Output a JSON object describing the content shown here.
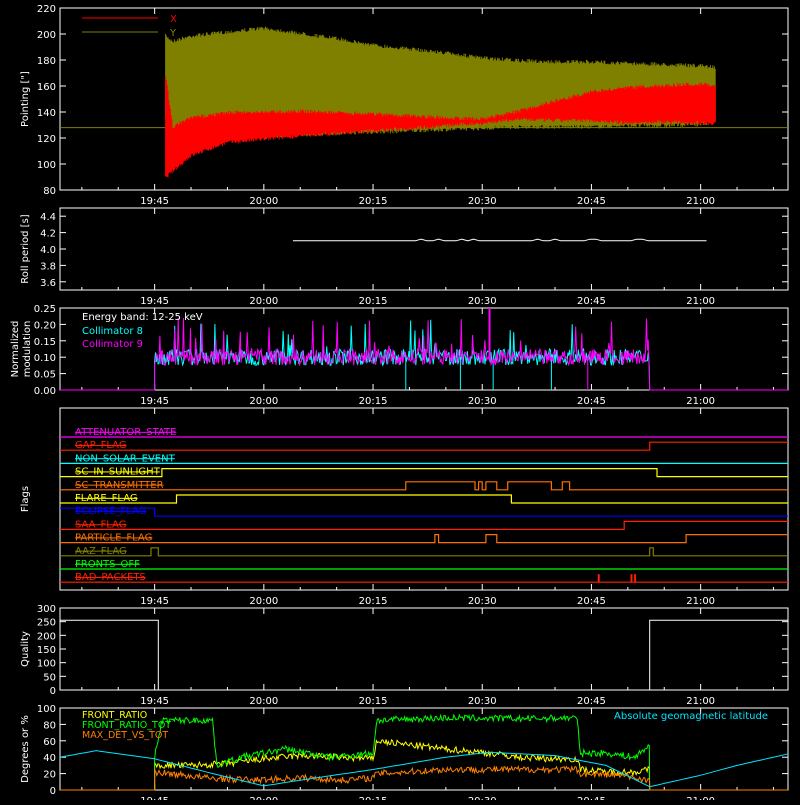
{
  "time_axis": {
    "tick_labels": [
      "19:45",
      "20:00",
      "20:15",
      "20:30",
      "20:45",
      "21:00"
    ],
    "tick_times_min": [
      0,
      15,
      30,
      45,
      60,
      75
    ],
    "range_min": [
      -13,
      87
    ]
  },
  "chart_data": [
    {
      "type": "line",
      "title": "",
      "ylabel": "Pointing [\"]",
      "ylim": [
        80,
        220
      ],
      "yticks": [
        80,
        100,
        120,
        140,
        160,
        180,
        200,
        220
      ],
      "legend": [
        "X",
        "Y"
      ],
      "series": [
        {
          "name": "X",
          "color": "#ff0000",
          "envelope": {
            "t": [
              1.5,
              2.5,
              5,
              10,
              20,
              30,
              40,
              45,
              50,
              55,
              60,
              65,
              70,
              75,
              77
            ],
            "hi": [
              170,
              130,
              137,
              141,
              142,
              140,
              137,
              136,
              142,
              150,
              157,
              160,
              162,
              163,
              162
            ],
            "lo": [
              88,
              93,
              105,
              115,
              120,
              124,
              128,
              130,
              133,
              132,
              132,
              130,
              131,
              130,
              130
            ]
          }
        },
        {
          "name": "Y",
          "color": "#808000",
          "envelope": {
            "t": [
              1.5,
              2.5,
              5,
              10,
              15,
              20,
              25,
              30,
              35,
              40,
              45,
              50,
              55,
              60,
              65,
              70,
              75,
              77
            ],
            "hi": [
              200,
              196,
              200,
              203,
              206,
              202,
              198,
              193,
              190,
              187,
              183,
              181,
              180,
              180,
              179,
              178,
              177,
              176
            ],
            "lo": [
              135,
              126,
              122,
              120,
              119,
              121,
              122,
              123,
              124,
              125,
              126,
              127,
              127,
              127,
              128,
              128,
              129,
              130
            ]
          }
        }
      ],
      "baseline": 128
    },
    {
      "type": "line",
      "title": "",
      "ylabel": "Roll period [s]",
      "ylim": [
        3.5,
        4.5
      ],
      "yticks": [
        3.6,
        3.8,
        4.0,
        4.2,
        4.4
      ],
      "series": [
        {
          "name": "",
          "color": "#ffffff",
          "t_start": 19,
          "t_end": 76,
          "value": 4.1
        }
      ]
    },
    {
      "type": "line",
      "title": "",
      "ylabel": "Normalized modulation",
      "ylim": [
        0,
        0.25
      ],
      "yticks": [
        0.0,
        0.05,
        0.1,
        0.15,
        0.2,
        0.25
      ],
      "annotation": "Energy band: 12-25 keV",
      "series": [
        {
          "name": "Collimator 8",
          "color": "#00ffff",
          "t_start": 0,
          "t_end": 68,
          "mean": 0.1,
          "dropouts": [
            34.5,
            42,
            46.5,
            54.5
          ]
        },
        {
          "name": "Collimator 9",
          "color": "#ff00ff",
          "t_start": 0,
          "t_end": 68,
          "mean": 0.1,
          "spike_t": 46,
          "spike_v": 0.27,
          "dropouts": [
            59.5
          ]
        }
      ]
    },
    {
      "type": "line",
      "title": "",
      "ylabel": "Flags",
      "flags": [
        {
          "name": "ATTENUATOR_STATE",
          "color": "#ff00ff",
          "segments": [
            [
              -13,
              87,
              0
            ]
          ]
        },
        {
          "name": "GAP_FLAG",
          "color": "#ff2000",
          "segments": [
            [
              -13,
              68,
              0
            ],
            [
              68,
              87,
              1
            ]
          ]
        },
        {
          "name": "NON_SOLAR_EVENT",
          "color": "#00ffff",
          "segments": [
            [
              -13,
              87,
              0
            ]
          ]
        },
        {
          "name": "SC_IN_SUNLIGHT",
          "color": "#ffff00",
          "segments": [
            [
              -13,
              1,
              0
            ],
            [
              1,
              69,
              1
            ],
            [
              69,
              87,
              0
            ]
          ]
        },
        {
          "name": "SC_TRANSMITTER",
          "color": "#ff7000",
          "segments": [
            [
              -13,
              34.5,
              0
            ],
            [
              34.5,
              44,
              1
            ],
            [
              44,
              44.5,
              0
            ],
            [
              44.5,
              45,
              1
            ],
            [
              45,
              45.5,
              0
            ],
            [
              45.5,
              47,
              1
            ],
            [
              47,
              48.5,
              0
            ],
            [
              48.5,
              54.5,
              1
            ],
            [
              54.5,
              56,
              0
            ],
            [
              56,
              57,
              1
            ],
            [
              57,
              87,
              0
            ]
          ]
        },
        {
          "name": "FLARE_FLAG",
          "color": "#ffff00",
          "segments": [
            [
              -13,
              3,
              0
            ],
            [
              3,
              49,
              1
            ],
            [
              49,
              87,
              0
            ]
          ]
        },
        {
          "name": "ECLIPSE_FLAG",
          "color": "#0000ff",
          "segments": [
            [
              -13,
              0,
              1
            ],
            [
              0,
              87,
              0
            ]
          ]
        },
        {
          "name": "SAA_FLAG",
          "color": "#ff2000",
          "segments": [
            [
              -13,
              64.5,
              0
            ],
            [
              64.5,
              87,
              1
            ]
          ]
        },
        {
          "name": "PARTICLE_FLAG",
          "color": "#ff7000",
          "segments": [
            [
              -13,
              38.5,
              0
            ],
            [
              38.5,
              39,
              1
            ],
            [
              39,
              45.5,
              0
            ],
            [
              45.5,
              47,
              1
            ],
            [
              47,
              73,
              0
            ],
            [
              73,
              87,
              1
            ]
          ]
        },
        {
          "name": "AAZ_FLAG",
          "color": "#808000",
          "segments": [
            [
              -13,
              -0.5,
              0
            ],
            [
              -0.5,
              0.5,
              1
            ],
            [
              0.5,
              68,
              0
            ],
            [
              68,
              68.5,
              1
            ],
            [
              68.5,
              87,
              0
            ]
          ]
        },
        {
          "name": "FRONTS_OFF",
          "color": "#00ff00",
          "segments": [
            [
              -13,
              87,
              0
            ]
          ]
        },
        {
          "name": "BAD_PACKETS",
          "color": "#ff2000",
          "segments": [
            [
              -13,
              87,
              0
            ]
          ],
          "spikes": [
            61,
            65.5,
            66
          ]
        }
      ]
    },
    {
      "type": "line",
      "title": "",
      "ylabel": "Quality",
      "ylim": [
        0,
        300
      ],
      "yticks": [
        0,
        50,
        100,
        150,
        200,
        250,
        300
      ],
      "series": [
        {
          "name": "",
          "color": "#ffffff",
          "steps": [
            [
              -13,
              0.5,
              255
            ],
            [
              0.5,
              68,
              0
            ],
            [
              68,
              87,
              255
            ]
          ]
        }
      ]
    },
    {
      "type": "line",
      "title": "",
      "ylabel": "Degrees or %",
      "ylim": [
        0,
        100
      ],
      "yticks": [
        0,
        20,
        40,
        60,
        80,
        100
      ],
      "annotation": "Absolute geomagnetic latitude",
      "series": [
        {
          "name": "FRONT_RATIO",
          "color": "#ffff00",
          "t": [
            0,
            5,
            10,
            15,
            20,
            25,
            30,
            30.5,
            35,
            40,
            45,
            50,
            55,
            58,
            58.5,
            62,
            66,
            68
          ],
          "y": [
            30,
            30,
            32,
            38,
            42,
            40,
            38,
            60,
            55,
            50,
            46,
            40,
            38,
            38,
            25,
            22,
            22,
            25
          ]
        },
        {
          "name": "FRONT_RATIO_TOT",
          "color": "#00ff00",
          "t": [
            0,
            1,
            8,
            8.5,
            12,
            18,
            24,
            30,
            30.5,
            40,
            50,
            58,
            58.5,
            62,
            66,
            68
          ],
          "y": [
            40,
            85,
            85,
            30,
            40,
            50,
            40,
            45,
            85,
            88,
            87,
            88,
            45,
            45,
            40,
            55
          ]
        },
        {
          "name": "MAX_DET_VS_TOT",
          "color": "#ff8000",
          "t": [
            0,
            4,
            8,
            8.5,
            14,
            20,
            26,
            30,
            30.5,
            40,
            50,
            58,
            58.5,
            64,
            68
          ],
          "y": [
            22,
            18,
            14,
            14,
            12,
            15,
            12,
            15,
            20,
            25,
            25,
            25,
            20,
            18,
            12
          ]
        },
        {
          "name": "Absolute geomagnetic latitude",
          "color": "#00e5ff",
          "t": [
            -13,
            -8,
            0,
            8,
            15,
            20,
            30,
            40,
            46,
            55,
            62,
            68,
            75,
            80,
            87
          ],
          "y": [
            40,
            48,
            38,
            20,
            5,
            12,
            25,
            40,
            46,
            42,
            30,
            4,
            18,
            30,
            44
          ]
        }
      ]
    }
  ]
}
